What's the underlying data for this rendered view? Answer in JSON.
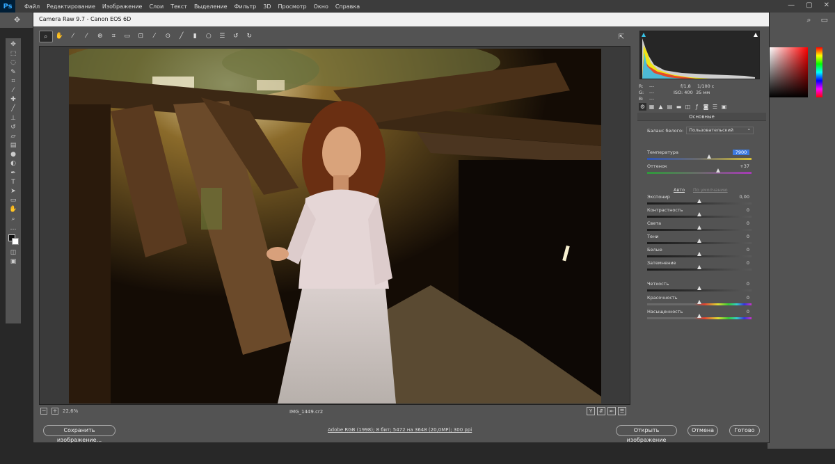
{
  "photoshop": {
    "logo": "Ps",
    "menu": [
      "Файл",
      "Редактирование",
      "Изображение",
      "Слои",
      "Текст",
      "Выделение",
      "Фильтр",
      "3D",
      "Просмотр",
      "Окно",
      "Справка"
    ],
    "window_controls": [
      "—",
      "▢",
      "✕"
    ]
  },
  "dialog": {
    "title": "Camera Raw 9.7  -  Canon EOS 6D",
    "zoom": "22,6%",
    "filename": "IMG_1449.cr2",
    "workflow": "Adobe RGB (1998); 8 бит; 5472 на 3648 (20,0МР); 300 ppi",
    "buttons": {
      "save": "Сохранить изображение...",
      "open": "Открыть изображение",
      "cancel": "Отмена",
      "done": "Готово"
    }
  },
  "camera_info": {
    "r": "R:",
    "g": "G:",
    "b": "B:",
    "r_val": "---",
    "g_val": "---",
    "b_val": "---",
    "aperture": "f/1,8",
    "shutter": "1/100 с",
    "iso": "ISO: 400",
    "focal": "35 мм"
  },
  "panel": {
    "section_title": "Основные",
    "wb_label": "Баланс белого:",
    "wb_value": "Пользовательский",
    "auto_label": "Авто",
    "default_label": "По умолчанию"
  },
  "sliders": [
    {
      "name": "temperature",
      "label": "Температура",
      "value": "7900",
      "position": 0.59,
      "highlight": true,
      "track": "temperature"
    },
    {
      "name": "tint",
      "label": "Оттенок",
      "value": "+37",
      "position": 0.68,
      "track": "tint"
    },
    {
      "name": "exposure",
      "label": "Экспонир",
      "value": "0,00",
      "position": 0.5
    },
    {
      "name": "contrast",
      "label": "Контрастность",
      "value": "0",
      "position": 0.5
    },
    {
      "name": "highlights",
      "label": "Света",
      "value": "0",
      "position": 0.5
    },
    {
      "name": "shadows",
      "label": "Тени",
      "value": "0",
      "position": 0.5
    },
    {
      "name": "whites",
      "label": "Белые",
      "value": "0",
      "position": 0.5
    },
    {
      "name": "blacks",
      "label": "Затемнение",
      "value": "0",
      "position": 0.5
    },
    {
      "name": "clarity",
      "label": "Четкость",
      "value": "0",
      "position": 0.5
    },
    {
      "name": "vibrance",
      "label": "Красочность",
      "value": "0",
      "position": 0.5,
      "track": "rainbow"
    },
    {
      "name": "saturation",
      "label": "Насыщенность",
      "value": "0",
      "position": 0.5,
      "track": "rainbow"
    }
  ],
  "icons": {
    "cr_toolbar": [
      "zoom-icon",
      "hand-icon",
      "white-balance-icon",
      "color-sampler-icon",
      "target-adjust-icon",
      "crop-icon",
      "straighten-icon",
      "transform-icon",
      "spot-removal-icon",
      "red-eye-icon",
      "adjustment-brush-icon",
      "graduated-filter-icon",
      "radial-filter-icon",
      "preferences-icon",
      "rotate-left-icon",
      "rotate-right-icon"
    ],
    "panel_tabs": [
      "basic-icon",
      "tone-curve-icon",
      "detail-icon",
      "hsl-icon",
      "split-toning-icon",
      "lens-icon",
      "fx-icon",
      "camera-calibration-icon",
      "presets-icon",
      "snapshots-icon"
    ]
  },
  "colors": {
    "highlight": "#3d7ae0",
    "ps_blue": "#31a8ff"
  }
}
